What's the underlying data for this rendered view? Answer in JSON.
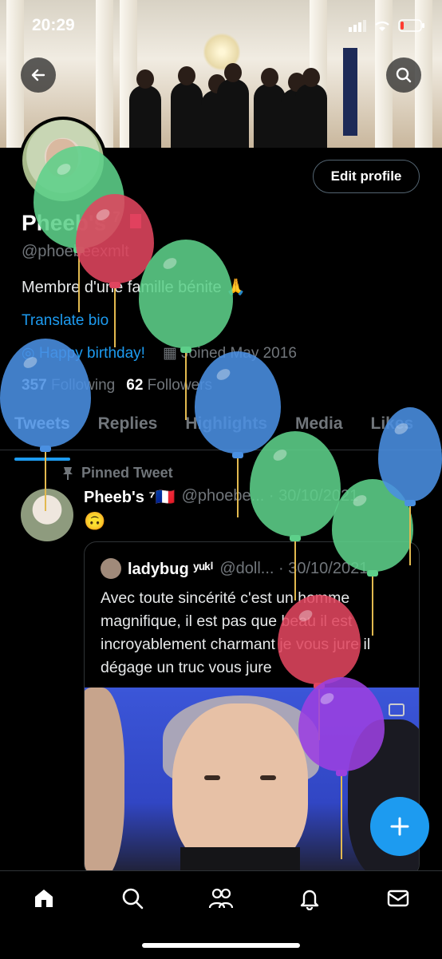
{
  "status_bar": {
    "time": "20:29"
  },
  "profile": {
    "edit_label": "Edit profile",
    "name": "Pheeb's",
    "name_sup": "7",
    "handle": "@phoebeexmlt",
    "bio": "Membre d'une famille bénite 🙏",
    "translate": "Translate bio",
    "birthday": "Happy birthday!",
    "joined": "Joined May 2016",
    "following_count": "357",
    "following_label": "Following",
    "followers_count": "62",
    "followers_label": "Followers"
  },
  "tabs": [
    {
      "label": "Tweets"
    },
    {
      "label": "Replies"
    },
    {
      "label": "Highlights"
    },
    {
      "label": "Media"
    },
    {
      "label": "Likes"
    }
  ],
  "tweet": {
    "pinned_label": "Pinned Tweet",
    "author": "Pheeb's ⁷🇫🇷",
    "handle_date": "@phoebe... · 30/10/2021",
    "text": "🙃",
    "quote": {
      "author": "ladybug ʸᵘᵏⁱ",
      "handle_date": "@doll... · 30/10/2021",
      "text": "Avec toute sincérité c'est un homme magnifique, il est pas que beau il est incroyablement charmant je vous jure il dégage un truc vous jure"
    }
  },
  "nav": [
    "home-icon",
    "search-icon",
    "communities-icon",
    "notifications-icon",
    "messages-icon"
  ],
  "colors": {
    "accent": "#1d9bf0",
    "muted": "#71767b",
    "background": "#000000"
  }
}
